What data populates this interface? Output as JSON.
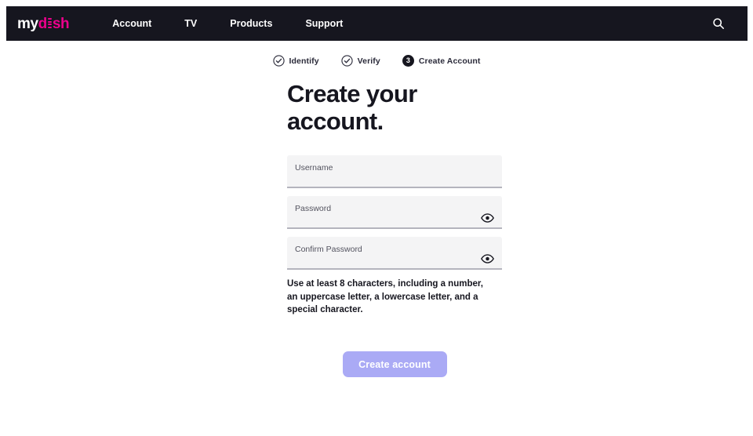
{
  "brand": {
    "logo_my": "my",
    "logo_d": "d",
    "logo_sh": "sh",
    "logo_full": "mydish",
    "color_white": "#ffffff",
    "color_pink": "#ec008c",
    "navbar_bg": "#16161f"
  },
  "navbar": {
    "links": [
      {
        "label": "Account",
        "name": "nav-link-account"
      },
      {
        "label": "TV",
        "name": "nav-link-tv"
      },
      {
        "label": "Products",
        "name": "nav-link-products"
      },
      {
        "label": "Support",
        "name": "nav-link-support"
      }
    ],
    "search_icon": "search-icon"
  },
  "stepper": {
    "steps": [
      {
        "label": "Identify",
        "state": "complete",
        "icon": "check-circle-icon",
        "number": "1"
      },
      {
        "label": "Verify",
        "state": "complete",
        "icon": "check-circle-icon",
        "number": "2"
      },
      {
        "label": "Create Account",
        "state": "current",
        "icon": "number-circle-icon",
        "number": "3"
      }
    ]
  },
  "main": {
    "title_line1": "Create your",
    "title_line2": "account.",
    "title": "Create your account.",
    "fields": [
      {
        "label": "Username",
        "value": "",
        "placeholder": "",
        "type": "text",
        "has_toggle": false
      },
      {
        "label": "Password",
        "value": "",
        "placeholder": "",
        "type": "password",
        "has_toggle": true,
        "toggle_icon": "eye-icon"
      },
      {
        "label": "Confirm Password",
        "value": "",
        "placeholder": "",
        "type": "password",
        "has_toggle": true,
        "toggle_icon": "eye-icon"
      }
    ],
    "helper_text": "Use at least 8 characters, including a number, an uppercase letter, a lowercase letter, and a special character.",
    "submit_label": "Create account",
    "submit_color": "#aaaaf5",
    "submit_disabled": true
  }
}
